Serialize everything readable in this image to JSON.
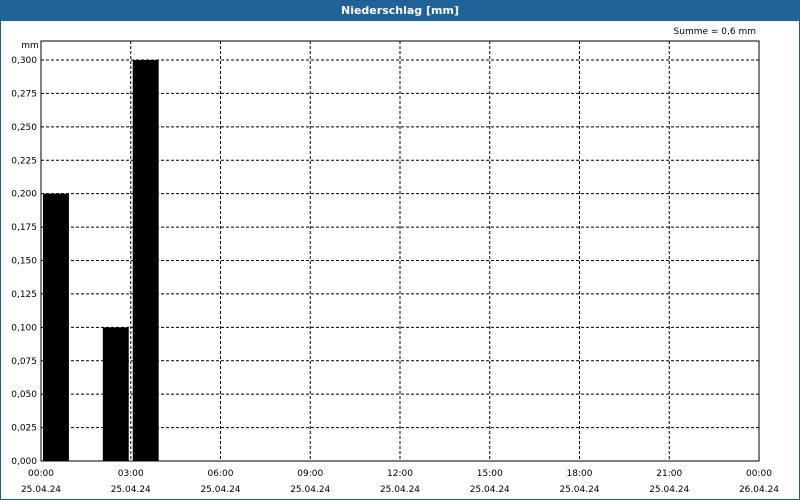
{
  "window": {
    "title": "Niederschlag [mm]"
  },
  "chart_data": {
    "type": "bar",
    "title": "Niederschlag [mm]",
    "ylabel": "mm",
    "summary": "Summe = 0,6 mm",
    "ylim": [
      0,
      0.3
    ],
    "y_ticks": [
      "0,000",
      "0,025",
      "0,050",
      "0,075",
      "0,100",
      "0,125",
      "0,150",
      "0,175",
      "0,200",
      "0,225",
      "0,250",
      "0,275",
      "0,300"
    ],
    "x_range_hours": [
      0,
      24
    ],
    "x_ticks": [
      {
        "time": "00:00",
        "date": "25.04.24"
      },
      {
        "time": "03:00",
        "date": "25.04.24"
      },
      {
        "time": "06:00",
        "date": "25.04.24"
      },
      {
        "time": "09:00",
        "date": "25.04.24"
      },
      {
        "time": "12:00",
        "date": "25.04.24"
      },
      {
        "time": "15:00",
        "date": "25.04.24"
      },
      {
        "time": "18:00",
        "date": "25.04.24"
      },
      {
        "time": "21:00",
        "date": "25.04.24"
      },
      {
        "time": "00:00",
        "date": "26.04.24"
      }
    ],
    "bars": [
      {
        "start_hour": 0,
        "end_hour": 1,
        "value": 0.2
      },
      {
        "start_hour": 2,
        "end_hour": 3,
        "value": 0.1
      },
      {
        "start_hour": 3,
        "end_hour": 4,
        "value": 0.3
      }
    ],
    "grid": true,
    "colors": {
      "bar": "#000000",
      "title_bar": "#1f6398"
    }
  }
}
